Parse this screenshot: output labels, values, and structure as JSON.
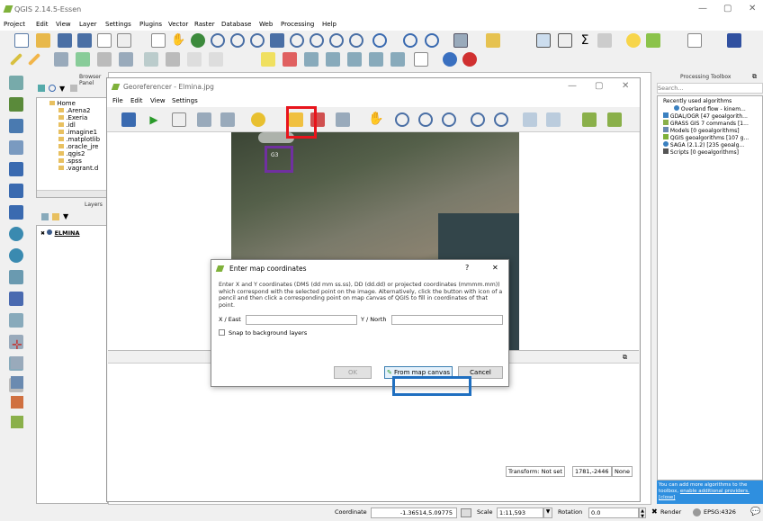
{
  "app": {
    "title": "QGIS 2.14.5-Essen",
    "window_controls": [
      "—",
      "▢",
      "✕"
    ],
    "menu": [
      "Project",
      "Edit",
      "View",
      "Layer",
      "Settings",
      "Plugins",
      "Vector",
      "Raster",
      "Database",
      "Web",
      "Processing",
      "Help"
    ]
  },
  "browser_panel": {
    "title": "Browser Panel",
    "items": [
      "Home",
      ".Arena2",
      ".Exeria",
      ".idl",
      ".imagine1",
      ".matplotlib",
      ".oracle_jre",
      ".qgis2",
      ".spss",
      ".vagrant.d"
    ]
  },
  "layers_panel": {
    "title": "Layers",
    "layer": "ELMINA"
  },
  "georeferencer": {
    "title": "Georeferencer - Elmina.jpg",
    "menu": [
      "File",
      "Edit",
      "View",
      "Settings"
    ],
    "point_label": "G3",
    "transform": "Transform: Not set",
    "coords": "1781,-2446",
    "crs": "None"
  },
  "dialog": {
    "title": "Enter map coordinates",
    "help": "?",
    "close": "✕",
    "description": "Enter X and Y coordinates (DMS (dd mm ss.ss), DD (dd.dd) or projected coordinates (mmmm.mm)) which correspond with the selected point on the image. Alternatively, click the button with icon of a pencil and then click a corresponding point on map canvas of QGIS to fill in coordinates of that point.",
    "x_label": "X / East",
    "y_label": "Y / North",
    "x_value": "",
    "y_value": "",
    "snap_label": "Snap to background layers",
    "ok_label": "OK",
    "from_canvas_label": "From map canvas",
    "cancel_label": "Cancel"
  },
  "processing": {
    "title": "Processing Toolbox",
    "search_placeholder": "Search...",
    "items": [
      "Recently used algorithms",
      "Overland flow - kinem...",
      "GDAL/OGR [47 geoalgorith...",
      "GRASS GIS 7 commands [1...",
      "Models [0 geoalgorithms]",
      "QGIS geoalgorithms [107 g...",
      "SAGA (2.1.2) [235 geoalg...",
      "Scripts [0 geoalgorithms]"
    ],
    "notice": "You can add more algorithms to the toolbox,",
    "notice_link": "enable additional providers.",
    "notice_close": "[close]"
  },
  "status": {
    "coordinate_label": "Coordinate",
    "coordinate_value": "-1.36514,5.09775",
    "scale_label": "Scale",
    "scale_value": "1:11,593",
    "rotation_label": "Rotation",
    "rotation_value": "0.0",
    "render_label": "Render",
    "crs": "EPSG:4326"
  },
  "colors": {
    "highlight_red": "#e8141c",
    "highlight_purple": "#7030a0",
    "highlight_blue": "#1f6fc0",
    "notice_bg": "#2f8fdf"
  }
}
